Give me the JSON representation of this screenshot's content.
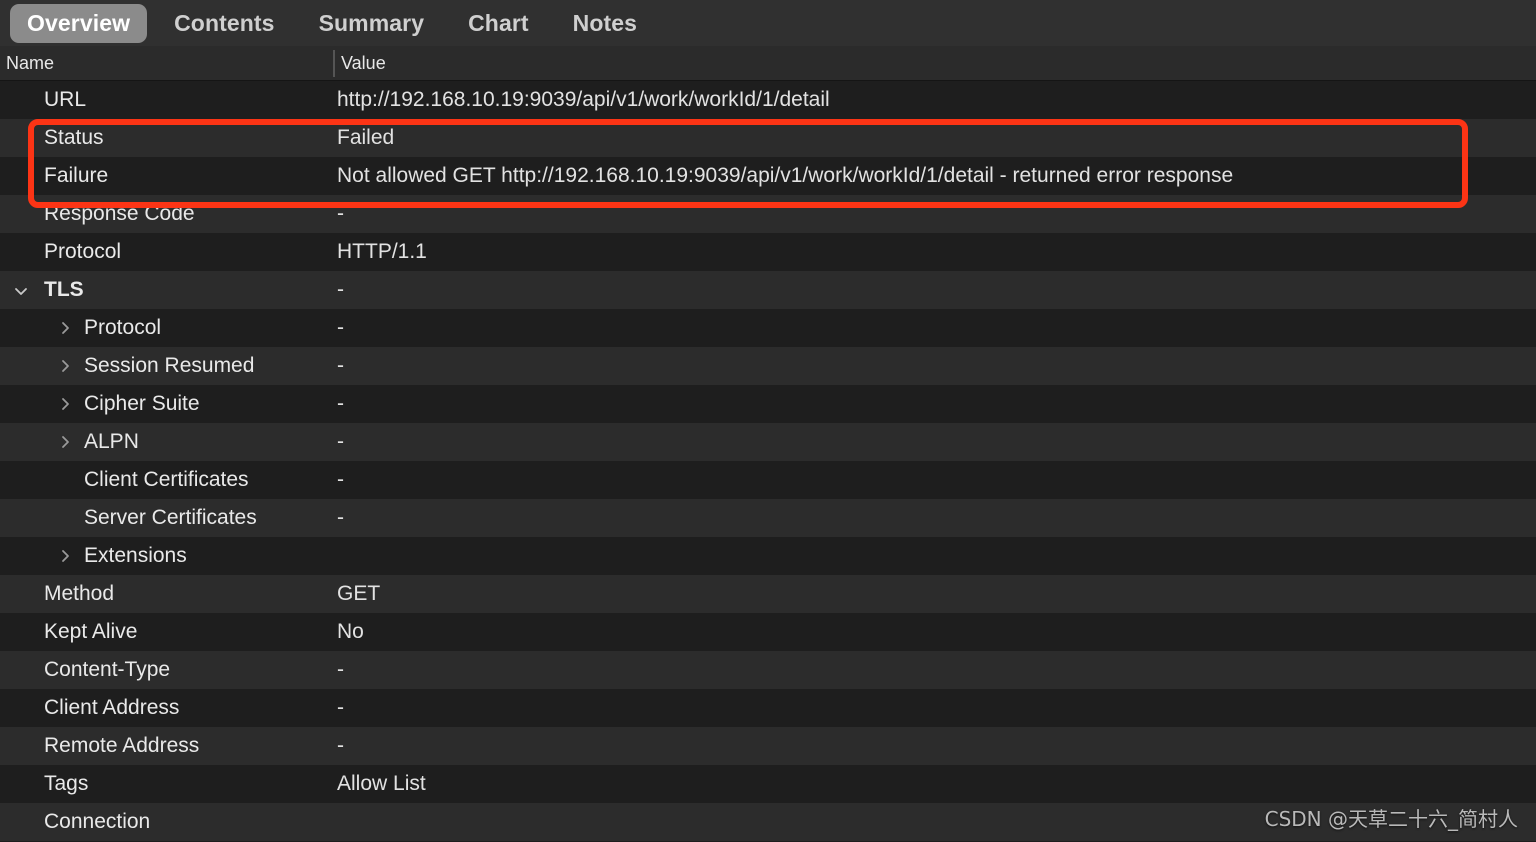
{
  "tabs": [
    {
      "label": "Overview",
      "active": true
    },
    {
      "label": "Contents",
      "active": false
    },
    {
      "label": "Summary",
      "active": false
    },
    {
      "label": "Chart",
      "active": false
    },
    {
      "label": "Notes",
      "active": false
    }
  ],
  "columns": {
    "name": "Name",
    "value": "Value"
  },
  "rows": [
    {
      "label": "URL",
      "value": "http://192.168.10.19:9039/api/v1/work/workId/1/detail",
      "depth": 0,
      "chevron": "none"
    },
    {
      "label": "Status",
      "value": "Failed",
      "depth": 0,
      "chevron": "none"
    },
    {
      "label": "Failure",
      "value": "Not allowed GET http://192.168.10.19:9039/api/v1/work/workId/1/detail - returned error response",
      "depth": 0,
      "chevron": "none"
    },
    {
      "label": "Response Code",
      "value": "-",
      "depth": 0,
      "chevron": "none"
    },
    {
      "label": "Protocol",
      "value": "HTTP/1.1",
      "depth": 0,
      "chevron": "none"
    },
    {
      "label": "TLS",
      "value": "-",
      "depth": 0,
      "chevron": "down",
      "group": true
    },
    {
      "label": "Protocol",
      "value": "-",
      "depth": 1,
      "chevron": "right"
    },
    {
      "label": "Session Resumed",
      "value": "-",
      "depth": 1,
      "chevron": "right"
    },
    {
      "label": "Cipher Suite",
      "value": "-",
      "depth": 1,
      "chevron": "right"
    },
    {
      "label": "ALPN",
      "value": "-",
      "depth": 1,
      "chevron": "right"
    },
    {
      "label": "Client Certificates",
      "value": "-",
      "depth": 1,
      "chevron": "none"
    },
    {
      "label": "Server Certificates",
      "value": "-",
      "depth": 1,
      "chevron": "none"
    },
    {
      "label": "Extensions",
      "value": "",
      "depth": 1,
      "chevron": "right"
    },
    {
      "label": "Method",
      "value": "GET",
      "depth": 0,
      "chevron": "none"
    },
    {
      "label": "Kept Alive",
      "value": "No",
      "depth": 0,
      "chevron": "none"
    },
    {
      "label": "Content-Type",
      "value": "-",
      "depth": 0,
      "chevron": "none"
    },
    {
      "label": "Client Address",
      "value": "-",
      "depth": 0,
      "chevron": "none"
    },
    {
      "label": "Remote Address",
      "value": "-",
      "depth": 0,
      "chevron": "none"
    },
    {
      "label": "Tags",
      "value": "Allow List",
      "depth": 0,
      "chevron": "none"
    },
    {
      "label": "Connection",
      "value": "",
      "depth": 0,
      "chevron": "none"
    }
  ],
  "annotation": {
    "name": "red-highlight-box",
    "color": "#fc3415",
    "covers": [
      "Status",
      "Failure"
    ]
  },
  "watermark": {
    "text": "CSDN @天草二十六_简村人"
  }
}
